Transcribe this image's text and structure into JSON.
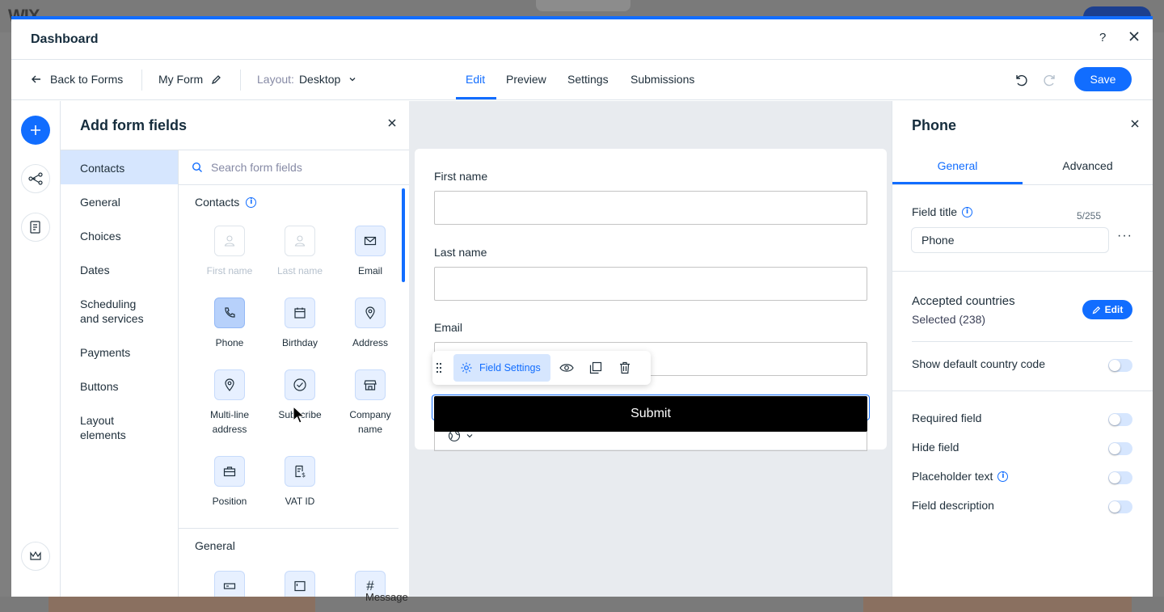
{
  "background": {
    "logo": "WIX",
    "message_label": "Message"
  },
  "modal": {
    "title": "Dashboard",
    "help": "?"
  },
  "toolbar": {
    "back_label": "Back to Forms",
    "form_name": "My Form",
    "layout_label": "Layout:",
    "layout_value": "Desktop",
    "tabs": [
      {
        "label": "Edit",
        "active": true
      },
      {
        "label": "Preview",
        "active": false
      },
      {
        "label": "Settings",
        "active": false
      },
      {
        "label": "Submissions",
        "active": false
      }
    ],
    "save_label": "Save"
  },
  "rail": {
    "icons": [
      "plus-icon",
      "connections-icon",
      "form-list-icon",
      "crown-icon"
    ]
  },
  "fields_panel": {
    "title": "Add form fields",
    "categories": [
      {
        "label": "Contacts",
        "active": true
      },
      {
        "label": "General",
        "active": false
      },
      {
        "label": "Choices",
        "active": false
      },
      {
        "label": "Dates",
        "active": false
      },
      {
        "label": "Scheduling and services",
        "active": false
      },
      {
        "label": "Payments",
        "active": false
      },
      {
        "label": "Buttons",
        "active": false
      },
      {
        "label": "Layout elements",
        "active": false
      }
    ],
    "search_placeholder": "Search form fields",
    "contacts_section_title": "Contacts",
    "general_section_title": "General",
    "fields": [
      {
        "label": "First name",
        "icon": "person-icon",
        "state": "disabled"
      },
      {
        "label": "Last name",
        "icon": "person-icon",
        "state": "disabled"
      },
      {
        "label": "Email",
        "icon": "envelope-icon",
        "state": "normal"
      },
      {
        "label": "Phone",
        "icon": "phone-icon",
        "state": "selected"
      },
      {
        "label": "Birthday",
        "icon": "calendar-icon",
        "state": "normal"
      },
      {
        "label": "Address",
        "icon": "location-pin-icon",
        "state": "normal"
      },
      {
        "label": "Multi-line address",
        "icon": "location-pin-icon",
        "state": "normal"
      },
      {
        "label": "Subscribe",
        "icon": "checkmark-circle-icon",
        "state": "normal"
      },
      {
        "label": "Company name",
        "icon": "store-icon",
        "state": "normal"
      },
      {
        "label": "Position",
        "icon": "briefcase-icon",
        "state": "normal"
      },
      {
        "label": "VAT ID",
        "icon": "receipt-icon",
        "state": "normal"
      }
    ],
    "general_fields": [
      {
        "icon": "short-text-icon"
      },
      {
        "icon": "long-text-icon"
      },
      {
        "icon": "number-icon",
        "glyph": "#"
      }
    ]
  },
  "form": {
    "first_name_label": "First name",
    "last_name_label": "Last name",
    "email_label": "Email",
    "submit_label": "Submit",
    "field_settings_label": "Field Settings"
  },
  "settings_panel": {
    "title": "Phone",
    "tabs": [
      {
        "label": "General",
        "active": true
      },
      {
        "label": "Advanced",
        "active": false
      }
    ],
    "field_title_label": "Field title",
    "field_title_value": "Phone",
    "char_count": "5/255",
    "accepted_countries_label": "Accepted countries",
    "selected_countries": "Selected (238)",
    "edit_label": "Edit",
    "toggles": [
      {
        "label": "Show default country code",
        "on": false,
        "info": false
      },
      {
        "label": "Required field",
        "on": false,
        "info": false
      },
      {
        "label": "Hide field",
        "on": false,
        "info": false
      },
      {
        "label": "Placeholder text",
        "on": false,
        "info": true
      },
      {
        "label": "Field description",
        "on": false,
        "info": false
      }
    ]
  },
  "colors": {
    "accent": "#116dff",
    "accent_light": "#d6e6fe",
    "text": "#20303c",
    "submit_bg": "#000000"
  }
}
